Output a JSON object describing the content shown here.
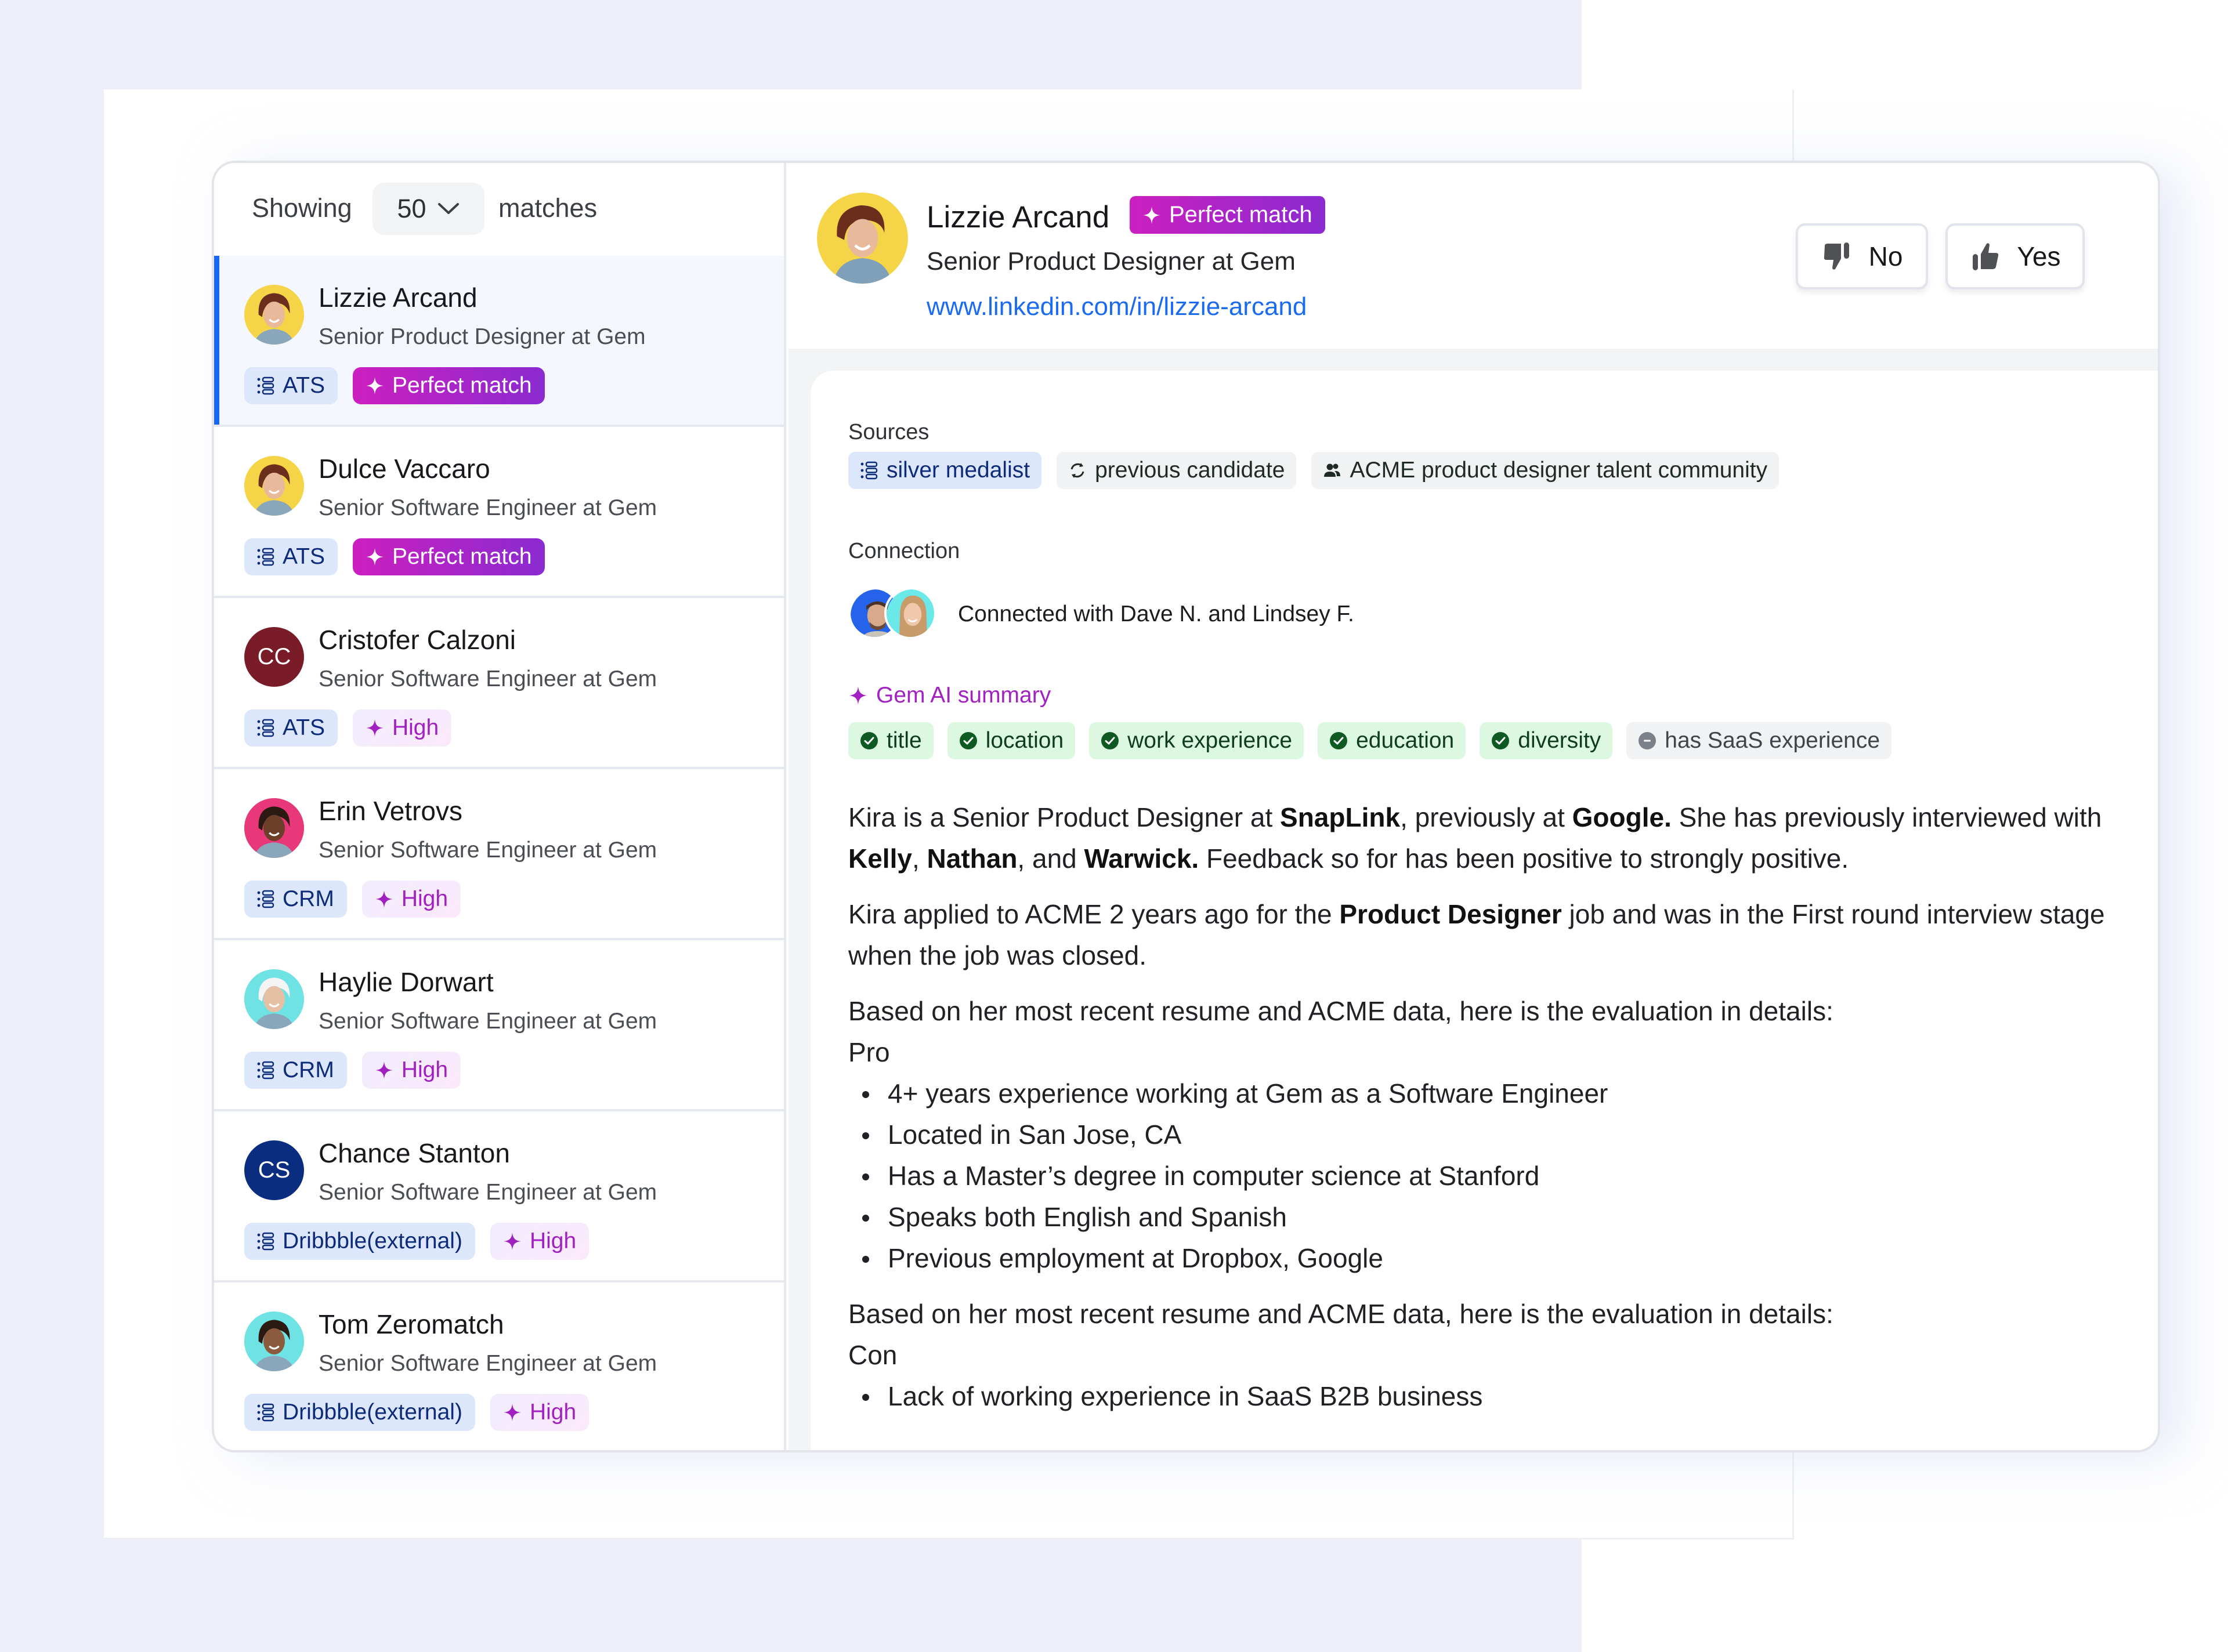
{
  "list": {
    "showing_label": "Showing",
    "count_value": "50",
    "matches_label": "matches",
    "candidates": [
      {
        "name": "Lizzie Arcand",
        "title": "Senior Product Designer at Gem",
        "avatar": "photo",
        "avatar_bg": "#f5d547",
        "source": "ATS",
        "match": "Perfect match",
        "match_type": "perfect",
        "selected": true
      },
      {
        "name": "Dulce Vaccaro",
        "title": "Senior Software Engineer at Gem",
        "avatar": "photo",
        "avatar_bg": "#f5d547",
        "source": "ATS",
        "match": "Perfect match",
        "match_type": "perfect",
        "selected": false
      },
      {
        "name": "Cristofer Calzoni",
        "title": "Senior Software Engineer at Gem",
        "avatar": "initials",
        "initials": "CC",
        "avatar_bg": "#7a1c28",
        "source": "ATS",
        "match": "High",
        "match_type": "high",
        "selected": false
      },
      {
        "name": "Erin Vetrovs",
        "title": "Senior Software Engineer at Gem",
        "avatar": "photo",
        "avatar_bg": "#e8387a",
        "source": "CRM",
        "match": "High",
        "match_type": "high",
        "selected": false
      },
      {
        "name": "Haylie Dorwart",
        "title": "Senior Software Engineer at Gem",
        "avatar": "photo",
        "avatar_bg": "#6fe3e3",
        "source": "CRM",
        "match": "High",
        "match_type": "high",
        "selected": false
      },
      {
        "name": "Chance Stanton",
        "title": "Senior Software Engineer at Gem",
        "avatar": "initials",
        "initials": "CS",
        "avatar_bg": "#0a2d80",
        "source": "Dribbble(external)",
        "match": "High",
        "match_type": "high",
        "selected": false
      },
      {
        "name": "Tom Zeromatch",
        "title": "Senior Software Engineer at Gem",
        "avatar": "photo",
        "avatar_bg": "#6fe3e3",
        "source": "Dribbble(external)",
        "match": "High",
        "match_type": "high",
        "selected": false
      }
    ]
  },
  "detail": {
    "name": "Lizzie Arcand",
    "match_badge": "Perfect match",
    "title": "Senior Product Designer at Gem",
    "linkedin": "www.linkedin.com/in/lizzie-arcand",
    "no_label": "No",
    "yes_label": "Yes",
    "sources_label": "Sources",
    "sources": [
      {
        "label": "silver medalist",
        "icon": "list-icon",
        "style": "blue"
      },
      {
        "label": "previous candidate",
        "icon": "refresh-icon",
        "style": "gray"
      },
      {
        "label": "ACME product designer talent community",
        "icon": "people-icon",
        "style": "gray"
      }
    ],
    "connection_label": "Connection",
    "connection_text": "Connected with Dave N. and Lindsey F.",
    "ai_summary_label": "Gem AI summary",
    "criteria": [
      {
        "label": "title",
        "status": "met"
      },
      {
        "label": "location",
        "status": "met"
      },
      {
        "label": "work experience",
        "status": "met"
      },
      {
        "label": "education",
        "status": "met"
      },
      {
        "label": "diversity",
        "status": "met"
      },
      {
        "label": "has SaaS experience",
        "status": "unmet"
      }
    ],
    "summary": {
      "p1": [
        {
          "t": "Kira is a Senior Product Designer at "
        },
        {
          "t": "SnapLink",
          "b": true
        },
        {
          "t": ", previously at "
        },
        {
          "t": "Google.",
          "b": true
        },
        {
          "t": " She has previously interviewed with "
        },
        {
          "t": "Kelly",
          "b": true
        },
        {
          "t": ", "
        },
        {
          "t": "Nathan",
          "b": true
        },
        {
          "t": ", and "
        },
        {
          "t": "Warwick.",
          "b": true
        },
        {
          "t": " Feedback so for has been positive to strongly positive."
        }
      ],
      "p2": [
        {
          "t": "Kira applied to ACME 2 years ago for the "
        },
        {
          "t": "Product Designer",
          "b": true
        },
        {
          "t": " job and was in the First round interview stage when the job was closed."
        }
      ],
      "pro_intro": "Based on her most recent resume and ACME data, here is the evaluation in details:",
      "pro_label": "Pro",
      "pros": [
        "4+ years experience working at Gem as a Software Engineer",
        "Located in San Jose, CA",
        "Has a Master’s degree in computer science at Stanford",
        "Speaks both English and Spanish",
        "Previous employment at Dropbox, Google"
      ],
      "con_intro": "Based on her most recent resume and ACME data, here is the evaluation in details:",
      "con_label": "Con",
      "cons": [
        "Lack of working experience in SaaS B2B business"
      ]
    }
  },
  "colors": {
    "accent_blue": "#1766f5",
    "link_blue": "#1a6bf0",
    "perfect_gradient_start": "#cc1fc0",
    "perfect_gradient_end": "#8a2bd0",
    "high_text": "#a020c0",
    "met_green": "#0f5a22",
    "unmet_gray": "#7c8089"
  }
}
